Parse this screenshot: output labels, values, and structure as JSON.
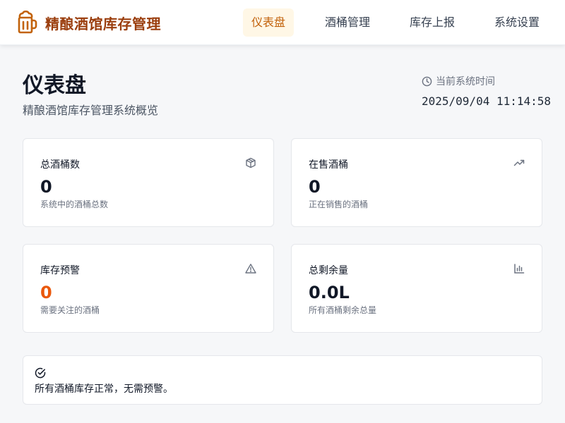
{
  "brand": {
    "title": "精酿酒馆库存管理",
    "icon": "beer-mug-icon",
    "color": "#9a3d0c"
  },
  "nav": [
    {
      "label": "仪表盘",
      "active": true
    },
    {
      "label": "酒桶管理",
      "active": false
    },
    {
      "label": "库存上报",
      "active": false
    },
    {
      "label": "系统设置",
      "active": false
    }
  ],
  "page": {
    "title": "仪表盘",
    "subtitle": "精酿酒馆库存管理系统概览"
  },
  "clock": {
    "label": "当前系统时间",
    "value": "2025/09/04 11:14:58",
    "icon": "clock-icon"
  },
  "stats": [
    {
      "title": "总酒桶数",
      "value": "0",
      "desc": "系统中的酒桶总数",
      "icon": "box-icon"
    },
    {
      "title": "在售酒桶",
      "value": "0",
      "desc": "正在销售的酒桶",
      "icon": "trending-up-icon"
    },
    {
      "title": "库存预警",
      "value": "0",
      "desc": "需要关注的酒桶",
      "icon": "warning-icon",
      "color": "#ea580c"
    },
    {
      "title": "总剩余量",
      "value": "0.0L",
      "desc": "所有酒桶剩余总量",
      "icon": "bar-chart-icon"
    }
  ],
  "alert": {
    "text": "所有酒桶库存正常，无需预警。",
    "icon": "check-circle-icon"
  },
  "colors": {
    "accent": "#c2620b",
    "active_bg": "#fff7e6",
    "warning": "#ea580c"
  }
}
